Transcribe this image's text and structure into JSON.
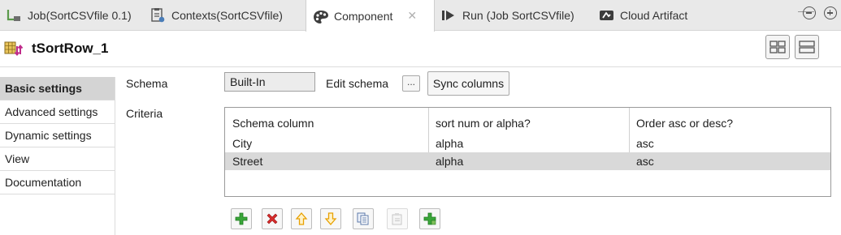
{
  "tabs": [
    {
      "label": "Job(SortCSVfile 0.1)",
      "icon": "job-icon"
    },
    {
      "label": "Contexts(SortCSVfile)",
      "icon": "contexts-icon"
    },
    {
      "label": "Component",
      "icon": "palette-icon",
      "active": true
    },
    {
      "label": "Run (Job SortCSVfile)",
      "icon": "run-icon"
    },
    {
      "label": "Cloud Artifact",
      "icon": "cloud-artifact-icon"
    }
  ],
  "component": {
    "title": "tSortRow_1"
  },
  "nav": {
    "items": [
      "Basic settings",
      "Advanced settings",
      "Dynamic settings",
      "View",
      "Documentation"
    ],
    "selected": "Basic settings"
  },
  "schema": {
    "label": "Schema",
    "value": "Built-In",
    "edit_label": "Edit schema",
    "dots_label": "...",
    "sync_label": "Sync columns"
  },
  "criteria": {
    "label": "Criteria",
    "headers": [
      "Schema column",
      "sort num or alpha?",
      "Order asc or desc?"
    ],
    "rows": [
      [
        "City",
        "alpha",
        "asc"
      ],
      [
        "Street",
        "alpha",
        "asc"
      ]
    ],
    "selected_row": 1
  },
  "toolbar_icons": [
    "add-icon",
    "remove-icon",
    "move-up-icon",
    "move-down-icon",
    "copy-icon",
    "paste-icon",
    "push-icon"
  ],
  "colors": {
    "add": "#3aa63a",
    "remove": "#d62b2b",
    "arrow": "#e8a000",
    "selected_row": "#d9d9d9"
  }
}
